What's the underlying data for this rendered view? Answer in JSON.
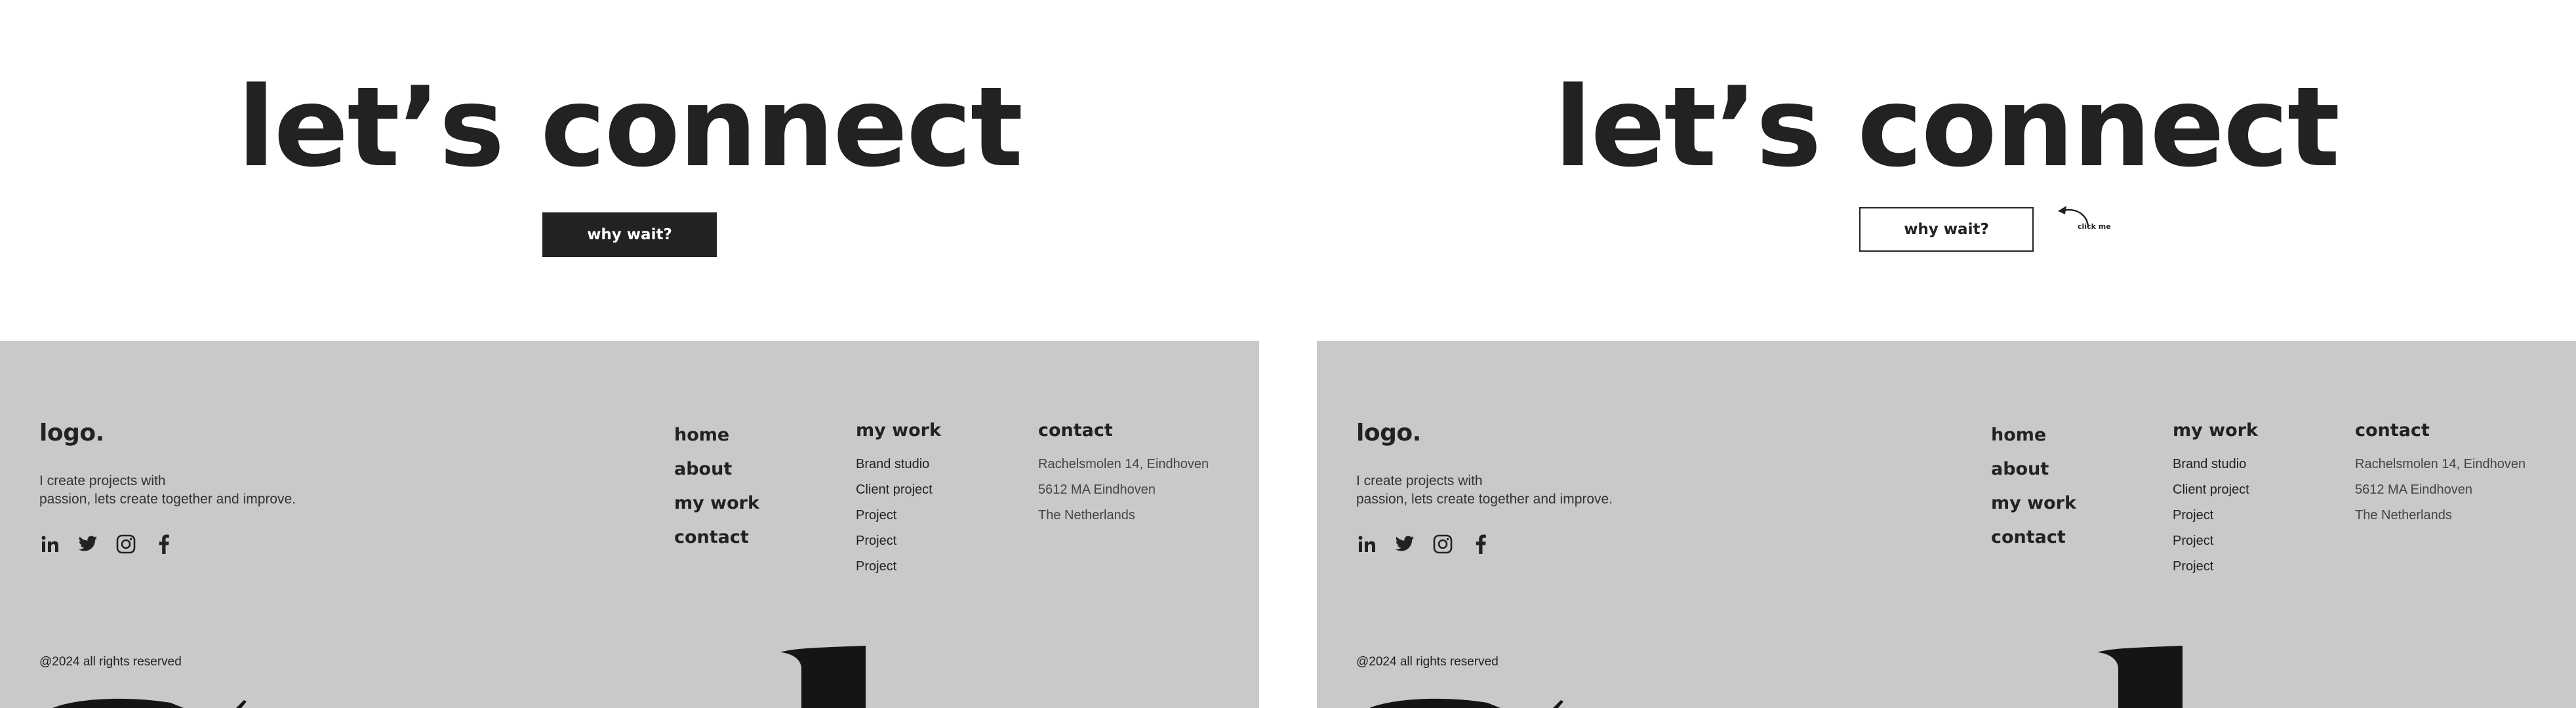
{
  "panels": [
    {
      "hero": {
        "title": "let’s connect",
        "button_label": "why wait?"
      },
      "footer": {
        "logo": "logo.",
        "tagline": [
          "I create projects with",
          "passion, lets create together and improve."
        ],
        "socials": [
          "linkedin-icon",
          "twitter-icon",
          "instagram-icon",
          "facebook-icon"
        ],
        "nav": {
          "items": [
            "home",
            "about",
            "my work",
            "contact"
          ]
        },
        "work": {
          "heading": "my work",
          "items": [
            "Brand studio",
            "Client project",
            "Project",
            "Project",
            "Project"
          ]
        },
        "contact": {
          "heading": "contact",
          "lines": [
            "Rachelsmolen 14, Eindhoven",
            "5612 MA Eindhoven",
            "The Netherlands"
          ]
        },
        "copyright": "@2024 all rights reserved"
      }
    },
    {
      "hero": {
        "title": "let’s connect",
        "button_label": "why wait?",
        "hint": "click me"
      },
      "footer": {
        "logo": "logo.",
        "tagline": [
          "I create projects with",
          "passion, lets create together and improve."
        ],
        "socials": [
          "linkedin-icon",
          "twitter-icon",
          "instagram-icon",
          "facebook-icon"
        ],
        "nav": {
          "items": [
            "home",
            "about",
            "my work",
            "contact"
          ]
        },
        "work": {
          "heading": "my work",
          "items": [
            "Brand studio",
            "Client project",
            "Project",
            "Project",
            "Project"
          ]
        },
        "contact": {
          "heading": "contact",
          "lines": [
            "Rachelsmolen 14, Eindhoven",
            "5612 MA Eindhoven",
            "The Netherlands"
          ]
        },
        "copyright": "@2024 all rights reserved"
      }
    }
  ],
  "colors": {
    "ink": "#222222",
    "footer_bg": "#c9c9c9",
    "page_bg": "#ffffff"
  }
}
